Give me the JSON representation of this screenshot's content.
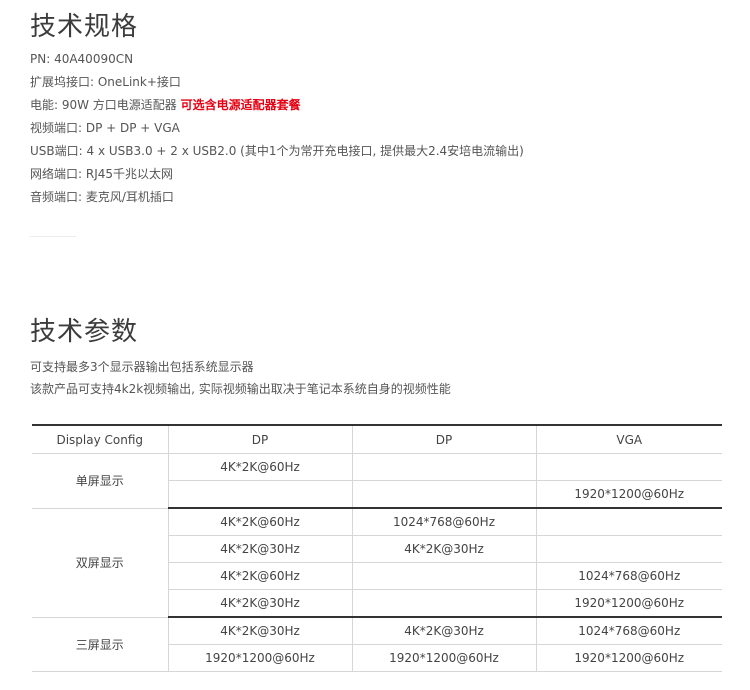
{
  "section1": {
    "title": "技术规格",
    "specs": [
      {
        "text": "PN: 40A40090CN",
        "highlight": ""
      },
      {
        "text": "扩展坞接口: OneLink+接口",
        "highlight": ""
      },
      {
        "text": "电能: 90W 方口电源适配器 ",
        "highlight": "可选含电源适配器套餐"
      },
      {
        "text": "视频端口: DP + DP + VGA",
        "highlight": ""
      },
      {
        "text": "USB端口: 4 x USB3.0 + 2 x USB2.0 (其中1个为常开充电接口, 提供最大2.4安培电流输出)",
        "highlight": ""
      },
      {
        "text": "网络端口: RJ45千兆以太网",
        "highlight": ""
      },
      {
        "text": "音频端口: 麦克风/耳机插口",
        "highlight": ""
      }
    ]
  },
  "section2": {
    "title": "技术参数",
    "lines": [
      "可支持最多3个显示器输出包括系统显示器",
      "该款产品可支持4k2k视频输出, 实际视频输出取决于笔记本系统自身的视频性能"
    ]
  },
  "table": {
    "headers": [
      "Display Config",
      "DP",
      "DP",
      "VGA"
    ],
    "groups": [
      {
        "label": "单屏显示",
        "rows": [
          [
            "4K*2K@60Hz",
            "",
            ""
          ],
          [
            "",
            "",
            "1920*1200@60Hz"
          ]
        ]
      },
      {
        "label": "双屏显示",
        "rows": [
          [
            "4K*2K@60Hz",
            "1024*768@60Hz",
            ""
          ],
          [
            "4K*2K@30Hz",
            "4K*2K@30Hz",
            ""
          ],
          [
            "4K*2K@60Hz",
            "",
            "1024*768@60Hz"
          ],
          [
            "4K*2K@30Hz",
            "",
            "1920*1200@60Hz"
          ]
        ]
      },
      {
        "label": "三屏显示",
        "rows": [
          [
            "4K*2K@30Hz",
            "4K*2K@30Hz",
            "1024*768@60Hz"
          ],
          [
            "1920*1200@60Hz",
            "1920*1200@60Hz",
            "1920*1200@60Hz"
          ]
        ]
      }
    ]
  },
  "colors": {
    "highlight": "#e60012",
    "rule": "#333333",
    "grid": "#d6d6d6"
  }
}
